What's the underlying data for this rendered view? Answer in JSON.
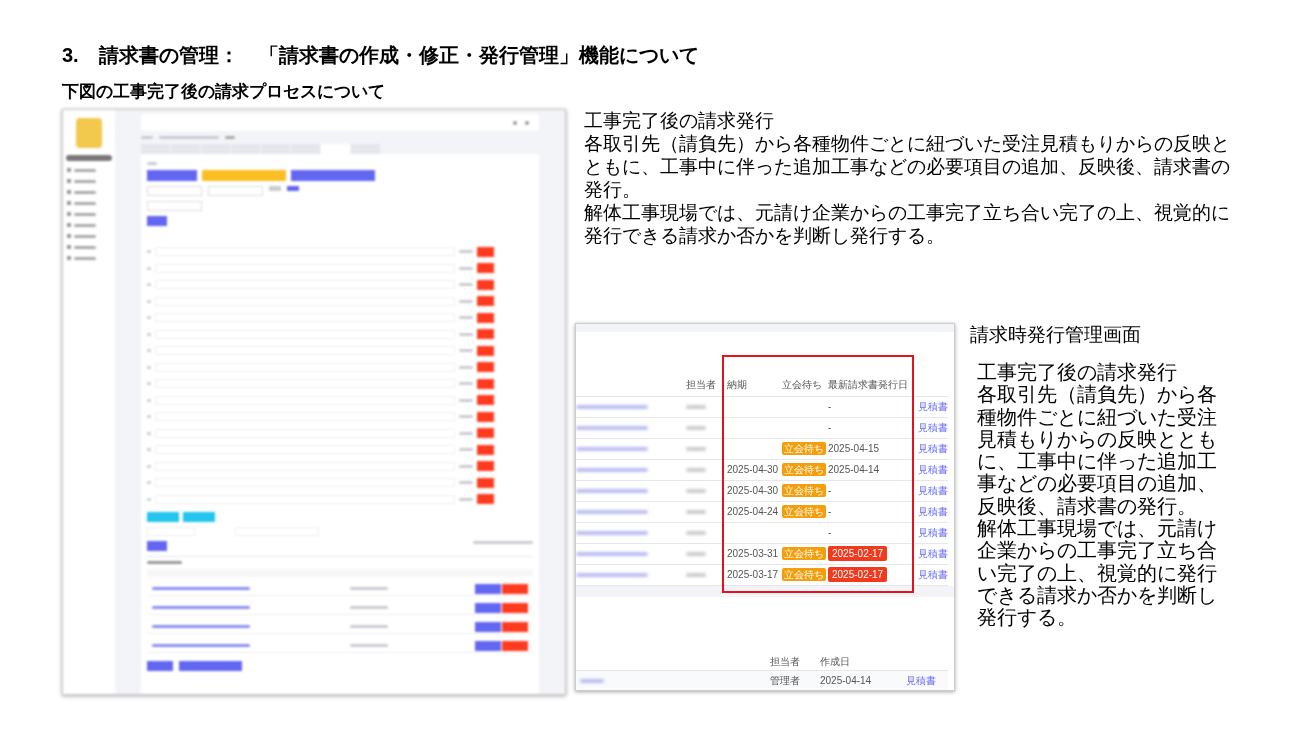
{
  "slide": {
    "title": "3.　請求書の管理：　「請求書の作成・修正・発行管理」機能について",
    "subtitle": "下図の工事完了後の請求プロセスについて"
  },
  "description": [
    "工事完了後の請求発行",
    "各取引先（請負先）から各種物件ごとに紐づいた受注見積もりからの反映とともに、工事中に伴った追加工事などの必要項目の追加、反映後、請求書の発行。",
    "解体工事現場では、元請け企業からの工事完了立ち合い完了の上、視覚的に発行できる請求か否かを判断し発行する。"
  ],
  "billing_screen": {
    "columns": [
      "担当者",
      "納期",
      "立会待ち",
      "最新請求書発行日"
    ],
    "rows": [
      {
        "last_invoice": "-",
        "overdue": false,
        "link": "見積書"
      },
      {
        "last_invoice": "-",
        "overdue": false,
        "link": "見積書"
      },
      {
        "badge": "立会待ち",
        "last_invoice": "2025-04-15",
        "overdue": false,
        "link": "見積書"
      },
      {
        "due": "2025-04-30",
        "badge": "立会待ち",
        "last_invoice": "2025-04-14",
        "overdue": false,
        "link": "見積書"
      },
      {
        "due": "2025-04-30",
        "badge": "立会待ち",
        "last_invoice": "-",
        "overdue": false,
        "link": "見積書"
      },
      {
        "due": "2025-04-24",
        "badge": "立会待ち",
        "last_invoice": "-",
        "overdue": false,
        "link": "見積書"
      },
      {
        "last_invoice": "-",
        "overdue": false,
        "link": "見積書"
      },
      {
        "due": "2025-03-31",
        "badge": "立会待ち",
        "last_invoice": "2025-02-17",
        "overdue": true,
        "link": "見積書"
      },
      {
        "due": "2025-03-17",
        "badge": "立会待ち",
        "last_invoice": "2025-02-17",
        "overdue": true,
        "link": "見積書"
      }
    ],
    "estimates": {
      "columns": [
        "担当者",
        "作成日"
      ],
      "rows": [
        {
          "assignee": "管理者",
          "created": "2025-04-14",
          "link": "見積書"
        }
      ]
    }
  },
  "screen_caption": "請求時発行管理画面",
  "side_notes": [
    "工事完了後の請求発行",
    "各取引先（請負先）から各種物件ごとに紐づいた受注見積もりからの反映とともに、工事中に伴った追加工事などの必要項目の追加、反映後、請求書の発行。",
    "解体工事現場では、元請け企業からの工事完了立ち合い完了の上、視覚的に発行できる請求か否かを判断し発行する。"
  ]
}
